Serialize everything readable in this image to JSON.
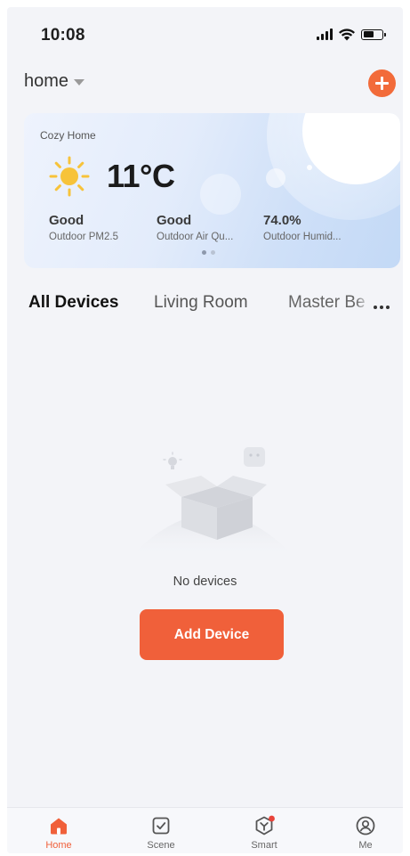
{
  "status_bar": {
    "time": "10:08"
  },
  "header": {
    "home_name": "home"
  },
  "weather": {
    "card_title": "Cozy Home",
    "temperature": "11°C",
    "metrics": [
      {
        "value": "Good",
        "label": "Outdoor PM2.5"
      },
      {
        "value": "Good",
        "label": "Outdoor Air Qu..."
      },
      {
        "value": "74.0%",
        "label": "Outdoor Humid..."
      }
    ],
    "page_count": 2,
    "active_page": 1
  },
  "tabs": [
    {
      "label": "All Devices",
      "active": true
    },
    {
      "label": "Living Room",
      "active": false
    },
    {
      "label": "Master Be",
      "active": false
    }
  ],
  "empty_state": {
    "message": "No devices",
    "button_label": "Add Device"
  },
  "bottom_nav": [
    {
      "label": "Home",
      "icon": "home-icon",
      "active": true
    },
    {
      "label": "Scene",
      "icon": "scene-icon",
      "active": false
    },
    {
      "label": "Smart",
      "icon": "smart-icon",
      "active": false,
      "badge": true
    },
    {
      "label": "Me",
      "icon": "profile-icon",
      "active": false
    }
  ],
  "colors": {
    "accent": "#f0603a",
    "background": "#f3f4f8",
    "sun": "#f7c33a"
  }
}
